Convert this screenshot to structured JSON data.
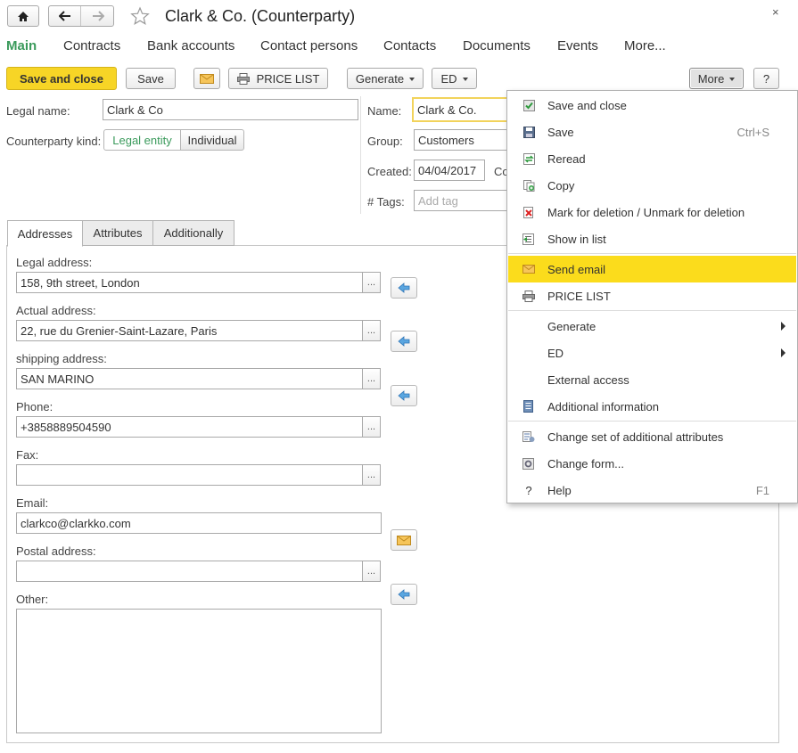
{
  "window": {
    "title": "Clark & Co. (Counterparty)"
  },
  "nav": {
    "tabs": [
      "Main",
      "Contracts",
      "Bank accounts",
      "Contact persons",
      "Contacts",
      "Documents",
      "Events",
      "More..."
    ]
  },
  "toolbar": {
    "save_close": "Save and close",
    "save": "Save",
    "price_list": "PRICE LIST",
    "generate": "Generate",
    "ed": "ED",
    "more": "More",
    "help": "?"
  },
  "form": {
    "legal_name_label": "Legal name:",
    "legal_name_value": "Clark & Co",
    "kind_label": "Counterparty kind:",
    "kind_options": [
      "Legal entity",
      "Individual"
    ],
    "name_label": "Name:",
    "name_value": "Clark & Co.",
    "group_label": "Group:",
    "group_value": "Customers",
    "created_label": "Created:",
    "created_value": "04/04/2017",
    "created_suffix": "Co",
    "tags_label": "# Tags:",
    "tags_placeholder": "Add tag"
  },
  "inner_tabs": [
    "Addresses",
    "Attributes",
    "Additionally"
  ],
  "addresses": {
    "legal_label": "Legal address:",
    "legal_value": "158, 9th street, London",
    "actual_label": "Actual address:",
    "actual_value": "22, rue du Grenier-Saint-Lazare, Paris",
    "shipping_label": "shipping address:",
    "shipping_value": "SAN MARINO",
    "phone_label": "Phone:",
    "phone_value": "+3858889504590",
    "fax_label": "Fax:",
    "fax_value": "",
    "email_label": "Email:",
    "email_value": "clarkco@clarkko.com",
    "postal_label": "Postal address:",
    "postal_value": "",
    "other_label": "Other:",
    "other_value": "",
    "dots": "..."
  },
  "menu": {
    "items": [
      {
        "label": "Save and close",
        "shortcut": "",
        "icon": "save-close-icon"
      },
      {
        "label": "Save",
        "shortcut": "Ctrl+S",
        "icon": "floppy-icon"
      },
      {
        "label": "Reread",
        "shortcut": "",
        "icon": "reread-icon"
      },
      {
        "label": "Copy",
        "shortcut": "",
        "icon": "copy-icon"
      },
      {
        "label": "Mark for deletion / Unmark for deletion",
        "shortcut": "",
        "icon": "delete-mark-icon"
      },
      {
        "label": "Show in list",
        "shortcut": "",
        "icon": "show-in-list-icon"
      },
      {
        "label": "Send email",
        "shortcut": "",
        "icon": "envelope-icon",
        "highlighted": true
      },
      {
        "label": "PRICE LIST",
        "shortcut": "",
        "icon": "printer-icon"
      },
      {
        "label": "Generate",
        "shortcut": "",
        "submenu": true
      },
      {
        "label": "ED",
        "shortcut": "",
        "submenu": true
      },
      {
        "label": "External access",
        "shortcut": ""
      },
      {
        "label": "Additional information",
        "shortcut": "",
        "icon": "info-list-icon"
      },
      {
        "label": "Change set of additional attributes",
        "shortcut": "",
        "icon": "attributes-icon"
      },
      {
        "label": "Change form...",
        "shortcut": "",
        "icon": "form-gear-icon"
      },
      {
        "label": "Help",
        "shortcut": "F1",
        "icon": "help-icon"
      }
    ],
    "highlight_color": "#fbdc1c"
  },
  "colors": {
    "accent_green": "#3a9a5b",
    "save_yellow": "#f7d526"
  }
}
